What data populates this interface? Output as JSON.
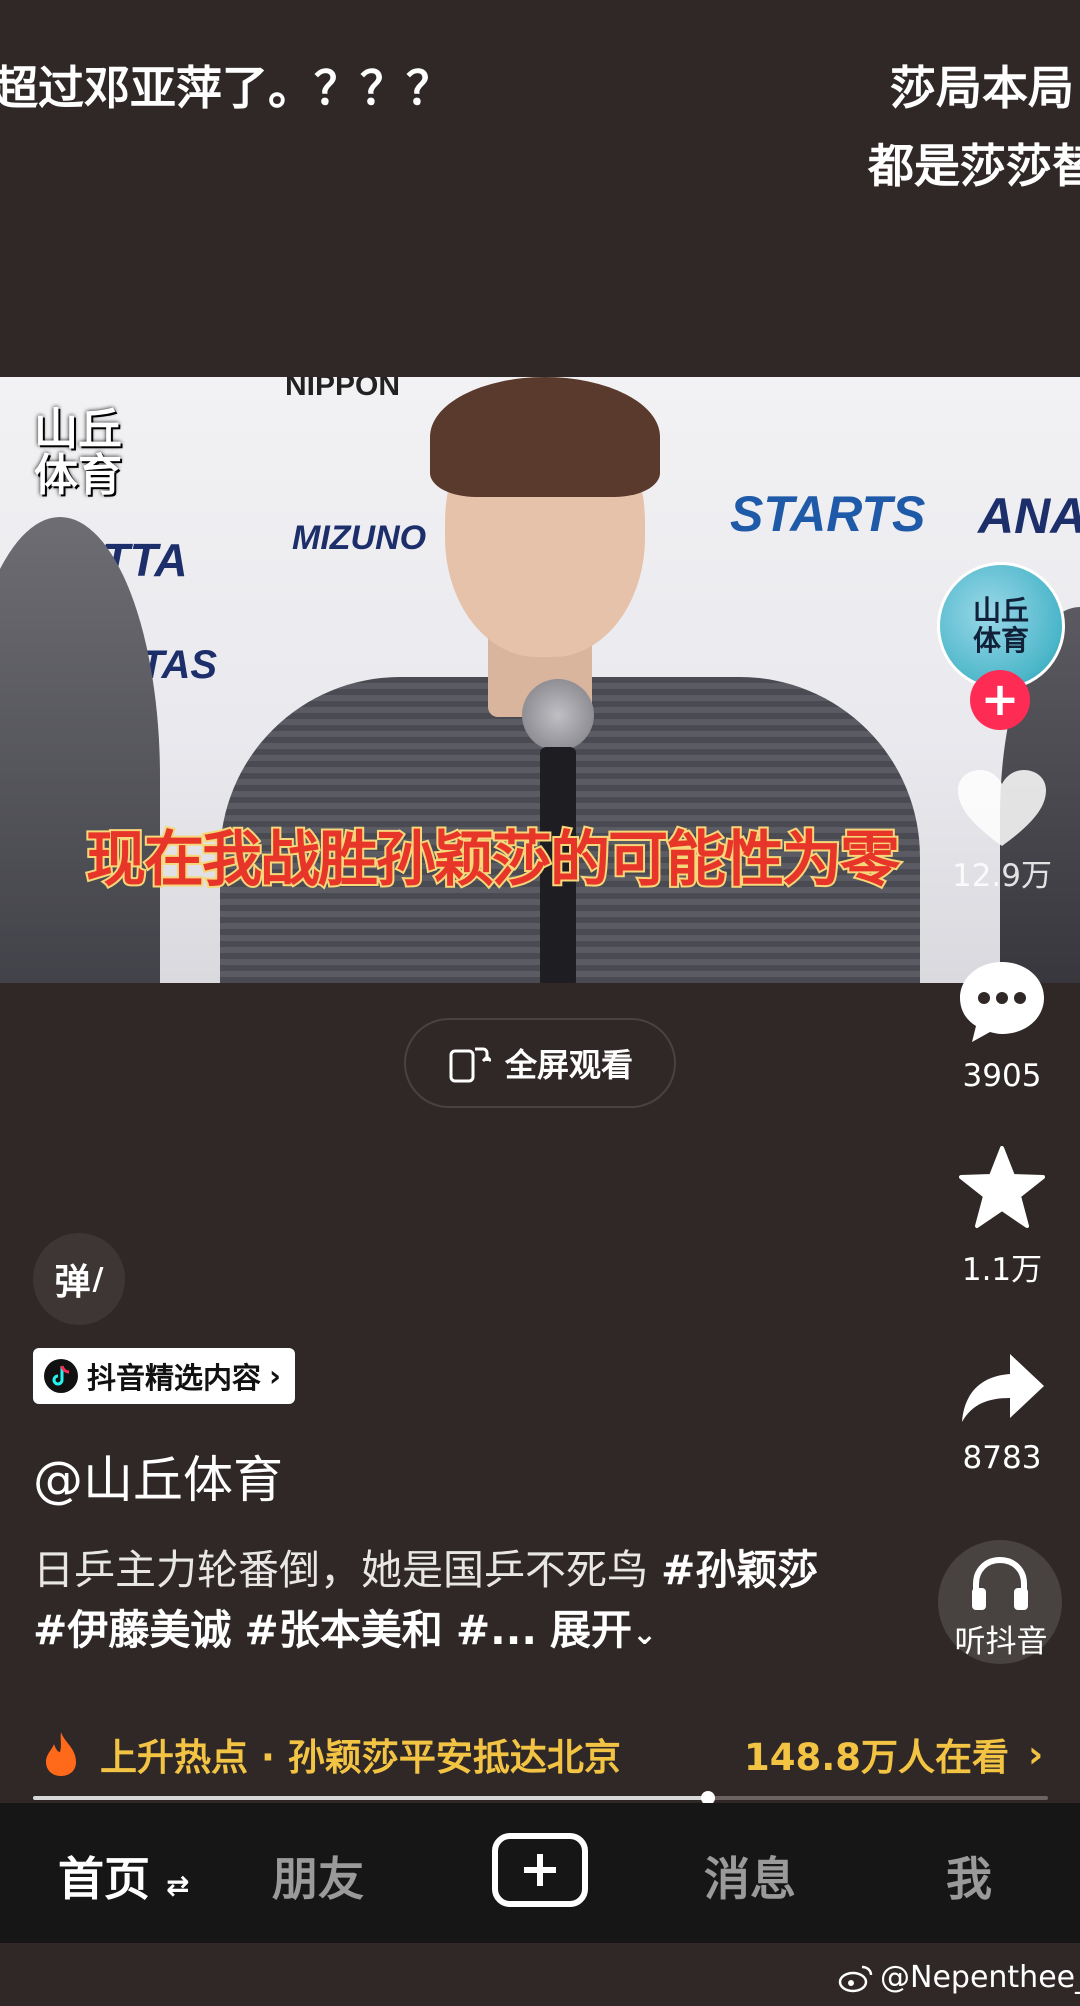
{
  "danmaku": [
    "超过邓亚萍了。？？？",
    "莎局本局",
    "都是莎莎替"
  ],
  "video": {
    "watermark": "山丘\n体育",
    "caption": "现在我战胜孙颖莎的可能性为零",
    "sponsors": [
      "JTTA",
      "MIZUNO",
      "STARTS",
      "ANA",
      "NIPPON",
      "TAS"
    ]
  },
  "fullscreen": {
    "label": "全屏观看",
    "icon": "rotate-screen-icon"
  },
  "sidebar": {
    "avatar_text": "山丘\n体育",
    "like_count": "12.9万",
    "comment_count": "3905",
    "favorite_count": "1.1万",
    "share_count": "8783",
    "listen_label": "听抖音"
  },
  "info": {
    "danmaku_toggle": "弹",
    "featured_badge": "抖音精选内容",
    "author": "@山丘体育",
    "desc_text": "日乒主力轮番倒，她是国乒不死鸟 ",
    "tags": [
      "#孙颖莎",
      "#伊藤美诚",
      "#张本美和",
      "#..."
    ],
    "expand": "展开"
  },
  "hot": {
    "title": "上升热点 · 孙颖莎平安抵达北京",
    "viewers": "148.8万人在看"
  },
  "progress": {
    "fraction": 0.665
  },
  "tabbar": {
    "home": "首页",
    "friends": "朋友",
    "messages": "消息",
    "me": "我"
  },
  "weibo_watermark": "@Nepenthee_",
  "colors": {
    "background": "#2f2827",
    "accent": "#fe2c55",
    "hot": "#f3c443",
    "tabbar": "#161616"
  }
}
